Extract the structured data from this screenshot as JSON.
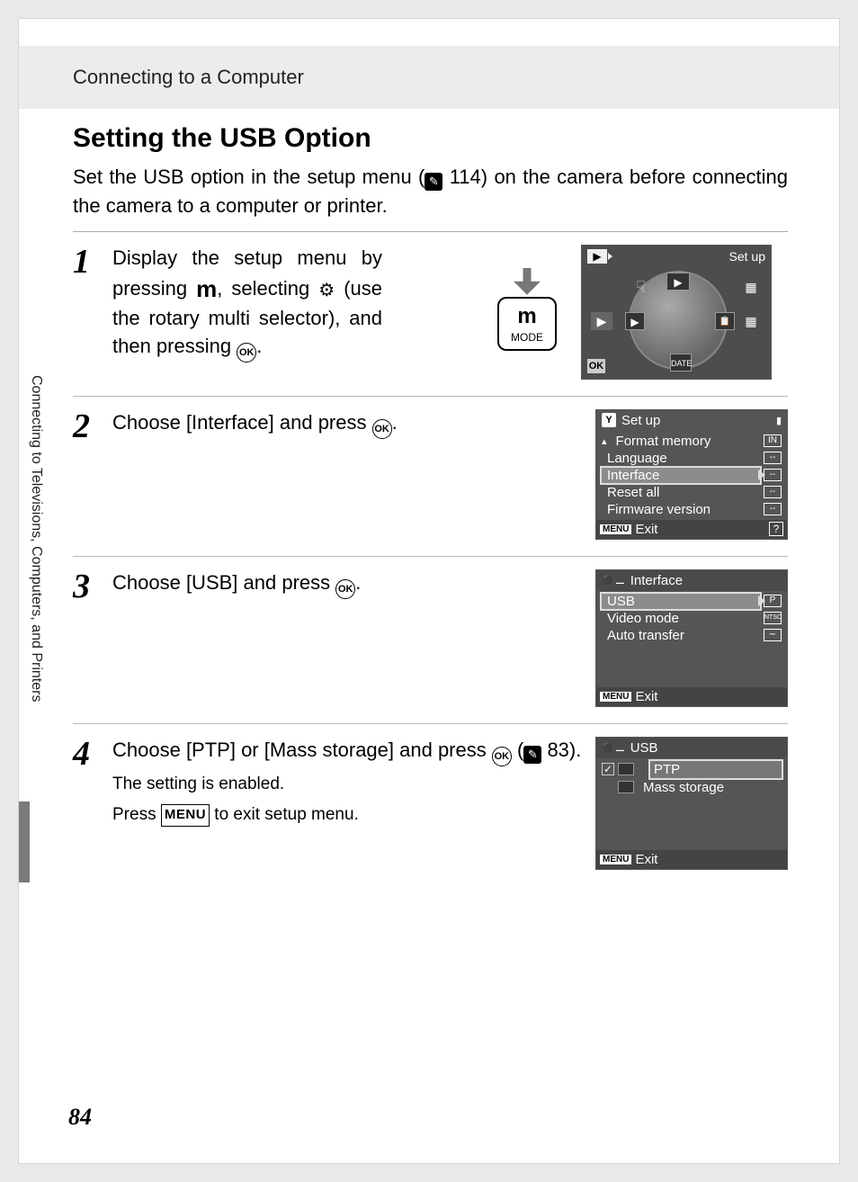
{
  "header": {
    "breadcrumb": "Connecting to a Computer"
  },
  "title": "Setting the USB Option",
  "intro": {
    "part1": "Set the USB option in the setup menu (",
    "pageref": "114",
    "part2": ") on the camera before connecting the camera to a computer or printer."
  },
  "steps": [
    {
      "num": "1",
      "text_a": "Display the setup menu by pressing ",
      "m_glyph": "m",
      "text_b": ", selecting ",
      "wrench_glyph": "⚙",
      "text_c": " (use the rotary multi selector), and then pressing ",
      "ok_glyph": "OK",
      "text_d": "."
    },
    {
      "num": "2",
      "text_a": "Choose [Interface] and press ",
      "ok_glyph": "OK",
      "text_b": "."
    },
    {
      "num": "3",
      "text_a": "Choose [USB] and press ",
      "ok_glyph": "OK",
      "text_b": "."
    },
    {
      "num": "4",
      "text_a": "Choose [PTP] or [Mass storage] and press ",
      "ok_glyph": "OK",
      "text_b": " (",
      "pageref": "83",
      "text_c": ").",
      "sub1": "The setting is enabled.",
      "sub2a": "Press ",
      "menu_glyph": "MENU",
      "sub2b": " to exit setup menu."
    }
  ],
  "mode_button": {
    "glyph": "m",
    "label": "MODE"
  },
  "dial_lcd": {
    "top_left_icon": "▶",
    "top_right": "Set up",
    "quad_top": "▶",
    "quad_bottom": "DATE",
    "quad_left": "▶",
    "quad_right": "📋",
    "side_left": "▶",
    "ok": "OK"
  },
  "lcd_setup": {
    "header_icon": "Y",
    "header_text": "Set up",
    "items": [
      {
        "label": "Format memory",
        "ind": "IN"
      },
      {
        "label": "Language",
        "ind": "--"
      },
      {
        "label": "Interface",
        "ind": "--",
        "selected": true
      },
      {
        "label": "Reset all",
        "ind": "--"
      },
      {
        "label": "Firmware version",
        "ind": "--"
      }
    ],
    "foot_btn": "MENU",
    "foot_text": "Exit",
    "help": "?"
  },
  "lcd_interface": {
    "header_text": "Interface",
    "items": [
      {
        "label": "USB",
        "ind": "P",
        "selected": true
      },
      {
        "label": "Video mode",
        "ind": "NTSC"
      },
      {
        "label": "Auto transfer",
        "ind": "∼"
      }
    ],
    "foot_btn": "MENU",
    "foot_text": "Exit"
  },
  "lcd_usb": {
    "header_text": "USB",
    "check": "✓",
    "items": [
      {
        "label": "PTP",
        "selected": true
      },
      {
        "label": "Mass storage"
      }
    ],
    "foot_btn": "MENU",
    "foot_text": "Exit"
  },
  "side_tab": "Connecting to Televisions, Computers, and Printers",
  "page_number": "84"
}
